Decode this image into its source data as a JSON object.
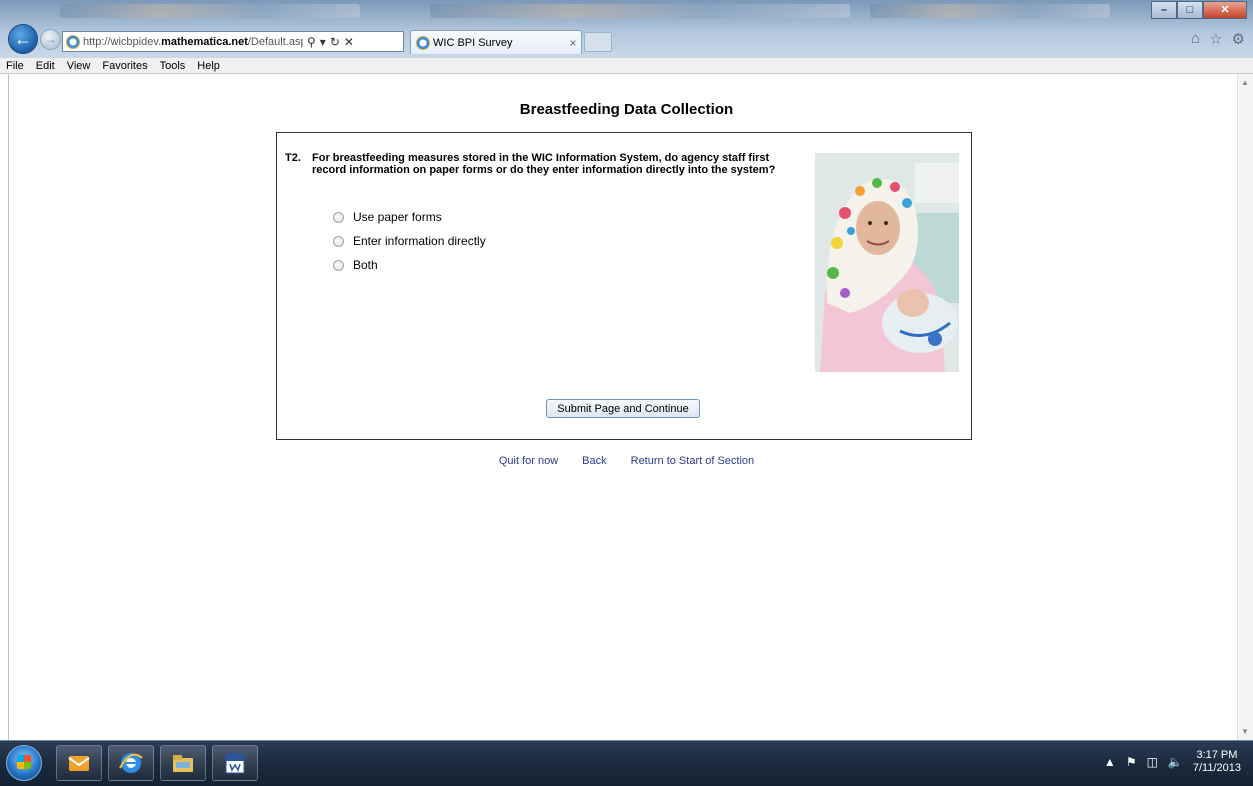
{
  "browser": {
    "url_prefix": "http://wicbpidev.",
    "url_host": "mathematica.net",
    "url_path": "/Default.aspx?Page=£",
    "tab_title": "WIC BPI Survey",
    "menu": [
      "File",
      "Edit",
      "View",
      "Favorites",
      "Tools",
      "Help"
    ]
  },
  "survey": {
    "page_title": "Breastfeeding Data Collection",
    "question_number": "T2.",
    "question_text": "For breastfeeding measures stored in the WIC Information System, do agency staff first record information on paper forms or do they enter information directly into the system?",
    "options": [
      "Use paper forms",
      "Enter information directly",
      "Both"
    ],
    "submit_label": "Submit Page and Continue",
    "links": [
      "Quit for now",
      "Back",
      "Return to Start of Section"
    ]
  },
  "taskbar": {
    "time": "3:17 PM",
    "date": "7/11/2013"
  },
  "colors": {
    "link": "#2a3a8c",
    "taskbar": "#1c2a3d",
    "titlebar": "#9eb6cf"
  }
}
